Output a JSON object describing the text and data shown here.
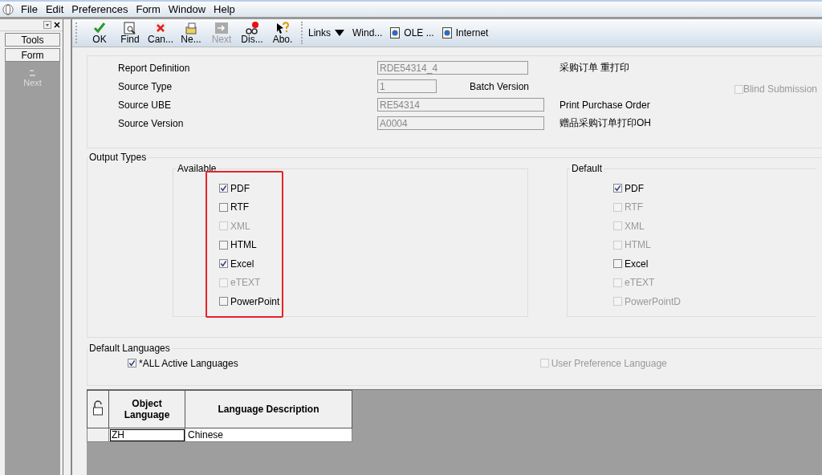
{
  "menu": [
    "File",
    "Edit",
    "Preferences",
    "Form",
    "Window",
    "Help"
  ],
  "sidebar": {
    "tabs": [
      {
        "label": "Tools"
      },
      {
        "label": "Form"
      }
    ],
    "items": [
      {
        "label": "Next",
        "disabled": true
      }
    ]
  },
  "toolbar": {
    "buttons": [
      {
        "label": "OK",
        "disabled": false
      },
      {
        "label": "Find",
        "disabled": false
      },
      {
        "label": "Can...",
        "disabled": false
      },
      {
        "label": "Ne...",
        "disabled": false
      },
      {
        "label": "Next",
        "disabled": true
      },
      {
        "label": "Dis...",
        "disabled": false
      },
      {
        "label": "Abo.",
        "disabled": false
      }
    ],
    "links": [
      {
        "label": "Links",
        "kind": "dropdown"
      },
      {
        "label": "Wind...",
        "kind": "plain"
      },
      {
        "label": "OLE ...",
        "kind": "doc"
      },
      {
        "label": "Internet",
        "kind": "doc"
      }
    ]
  },
  "header": {
    "fields": [
      {
        "label": "Report Definition",
        "value": "RDE54314_4",
        "note": "采购订单  重打印"
      },
      {
        "label": "Source Type",
        "value": "1",
        "note": "Batch Version"
      },
      {
        "label": "Source UBE",
        "value": "RE54314",
        "note": "Print Purchase Order"
      },
      {
        "label": "Source Version",
        "value": "A0004",
        "note": "赠品采购订单打印OH"
      }
    ],
    "blind_submission": {
      "label": "Blind Submission",
      "checked": false,
      "disabled": true
    }
  },
  "output_types": {
    "title": "Output Types",
    "groups": [
      {
        "title": "Available",
        "highlighted": true,
        "items": [
          {
            "label": "PDF",
            "checked": true,
            "disabled": false
          },
          {
            "label": "RTF",
            "checked": false,
            "disabled": false
          },
          {
            "label": "XML",
            "checked": false,
            "disabled": true
          },
          {
            "label": "HTML",
            "checked": false,
            "disabled": false
          },
          {
            "label": "Excel",
            "checked": true,
            "disabled": false
          },
          {
            "label": "eTEXT",
            "checked": false,
            "disabled": true
          },
          {
            "label": "PowerPoint",
            "checked": false,
            "disabled": false
          }
        ]
      },
      {
        "title": "Default",
        "highlighted": false,
        "items": [
          {
            "label": "PDF",
            "checked": true,
            "disabled": false
          },
          {
            "label": "RTF",
            "checked": false,
            "disabled": true
          },
          {
            "label": "XML",
            "checked": false,
            "disabled": true
          },
          {
            "label": "HTML",
            "checked": false,
            "disabled": true
          },
          {
            "label": "Excel",
            "checked": false,
            "disabled": false
          },
          {
            "label": "eTEXT",
            "checked": false,
            "disabled": true
          },
          {
            "label": "PowerPointD",
            "checked": false,
            "disabled": true
          }
        ]
      }
    ]
  },
  "default_languages": {
    "title": "Default Languages",
    "options": [
      {
        "label": "*ALL Active Languages",
        "checked": true,
        "disabled": false
      },
      {
        "label": "User Preference Language",
        "checked": false,
        "disabled": true
      }
    ]
  },
  "grid": {
    "columns": [
      "Object Language",
      "Language Description"
    ],
    "rows": [
      [
        "ZH",
        "Chinese"
      ]
    ]
  }
}
